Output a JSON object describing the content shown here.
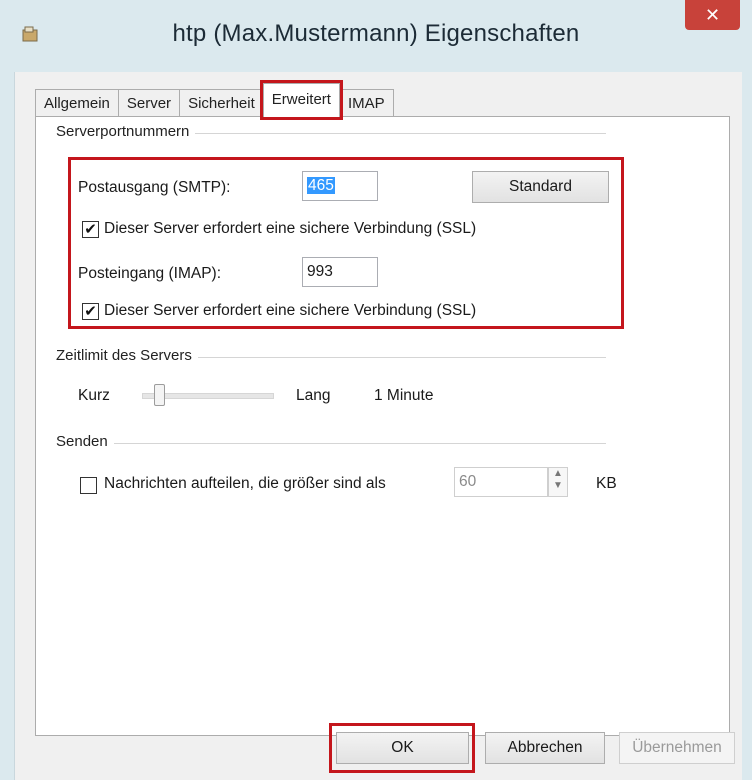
{
  "window": {
    "title": "htp (Max.Mustermann) Eigenschaften",
    "close_label": "✕"
  },
  "tabs": [
    {
      "label": "Allgemein"
    },
    {
      "label": "Server"
    },
    {
      "label": "Sicherheit"
    },
    {
      "label": "Erweitert"
    },
    {
      "label": "IMAP"
    }
  ],
  "active_tab": "Erweitert",
  "serverports": {
    "group_label": "Serverportnummern",
    "smtp_label": "Postausgang (SMTP):",
    "smtp_value": "465",
    "standard_button": "Standard",
    "smtp_ssl_label": "Dieser Server erfordert eine sichere Verbindung (SSL)",
    "smtp_ssl_checked": true,
    "imap_label": "Posteingang (IMAP):",
    "imap_value": "993",
    "imap_ssl_label": "Dieser Server erfordert eine sichere Verbindung (SSL)",
    "imap_ssl_checked": true
  },
  "timeout": {
    "group_label": "Zeitlimit des Servers",
    "short_label": "Kurz",
    "long_label": "Lang",
    "value_label": "1 Minute",
    "slider_fraction": 0.14
  },
  "send": {
    "group_label": "Senden",
    "split_label": "Nachrichten aufteilen, die größer sind als",
    "split_checked": false,
    "split_value": "60",
    "unit_label": "KB"
  },
  "buttons": {
    "ok": "OK",
    "cancel": "Abbrechen",
    "apply": "Übernehmen"
  },
  "colors": {
    "highlight_frame": "#c4161c",
    "selection": "#3399ff",
    "close_button": "#c8423a"
  }
}
